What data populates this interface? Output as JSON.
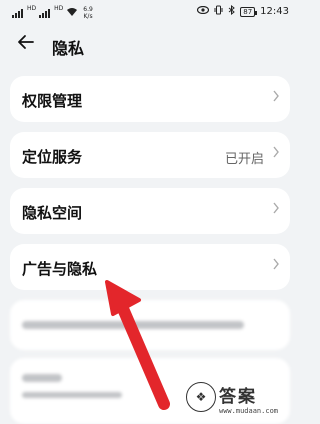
{
  "status_bar": {
    "network_tag_1": "HD",
    "network_tag_2": "HD",
    "speed_value": "6.9",
    "speed_unit": "K/s",
    "battery": "87",
    "time": "12:43"
  },
  "header": {
    "back_icon": "back-arrow-icon",
    "title": "隐私"
  },
  "settings_items": [
    {
      "label": "权限管理",
      "value": "",
      "icon": "chevron-right-icon"
    },
    {
      "label": "定位服务",
      "value": "已开启",
      "icon": "chevron-right-icon"
    },
    {
      "label": "隐私空间",
      "value": "",
      "icon": "chevron-right-icon"
    },
    {
      "label": "广告与隐私",
      "value": "",
      "icon": "chevron-right-icon"
    }
  ],
  "annotation": {
    "arrow_color": "#e3262b"
  },
  "watermark": {
    "text": "答案",
    "url": "www.mudaan.com",
    "logo_icon": "answer-logo-icon"
  }
}
